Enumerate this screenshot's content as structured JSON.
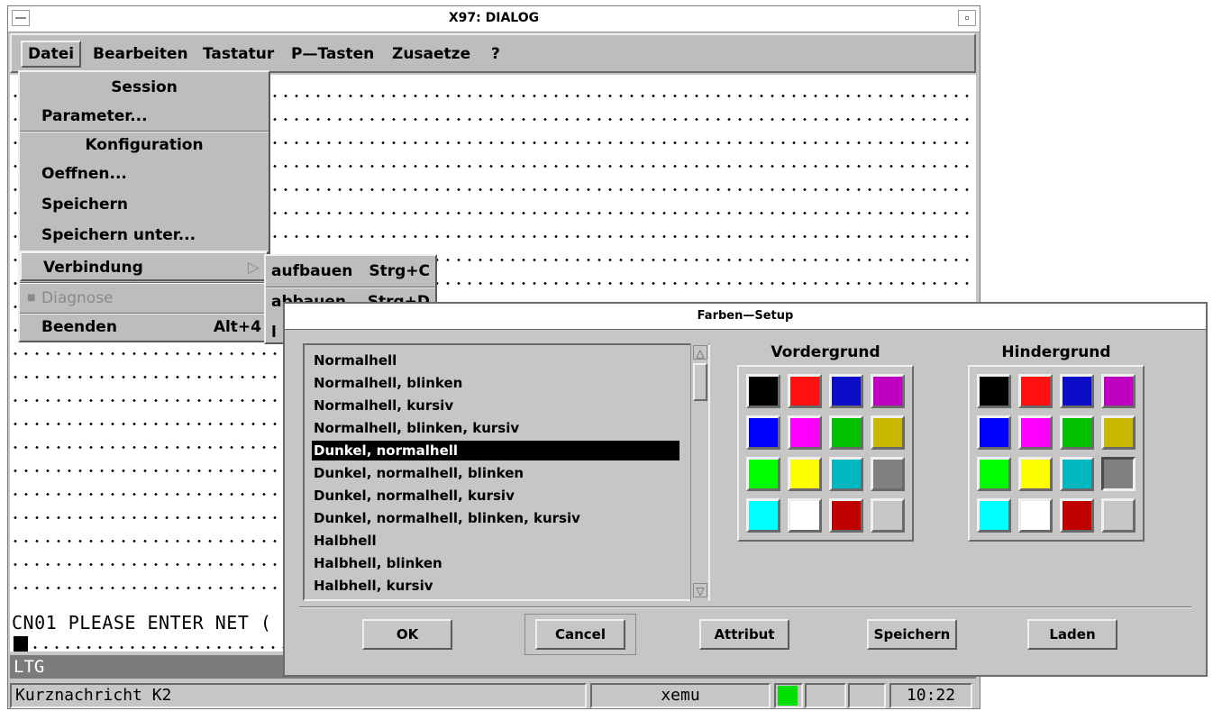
{
  "window": {
    "title": "X97: DIALOG"
  },
  "menubar": {
    "items": [
      {
        "label": "Datei"
      },
      {
        "label": "Bearbeiten"
      },
      {
        "label": "Tastatur"
      },
      {
        "label": "P—Tasten"
      },
      {
        "label": "Zusaetze"
      },
      {
        "label": "?"
      }
    ]
  },
  "datei_menu": {
    "session_header": "Session",
    "parameter": "Parameter...",
    "konfiguration_header": "Konfiguration",
    "oeffnen": "Oeffnen...",
    "speichern": "Speichern",
    "speichern_unter": "Speichern unter...",
    "verbindung": "Verbindung",
    "diagnose": "Diagnose",
    "beenden": "Beenden",
    "beenden_shortcut": "Alt+4"
  },
  "verbindung_submenu": {
    "aufbauen": "aufbauen",
    "aufbauen_shortcut": "Strg+C",
    "abbauen": "abbauen",
    "abbauen_shortcut": "Strg+D",
    "third": "l"
  },
  "terminal": {
    "message": "CN01 PLEASE ENTER NET (",
    "line_label": "LTG"
  },
  "statusbar": {
    "message": "Kurznachricht K2",
    "app": "xemu",
    "led_color": "#00e000",
    "time": "10:22"
  },
  "dialog": {
    "title": "Farben—Setup",
    "attributes": [
      "Normalhell",
      "Normalhell, blinken",
      "Normalhell, kursiv",
      "Normalhell, blinken, kursiv",
      "Dunkel, normalhell",
      "Dunkel, normalhell, blinken",
      "Dunkel, normalhell, kursiv",
      "Dunkel, normalhell, blinken, kursiv",
      "Halbhell",
      "Halbhell, blinken",
      "Halbhell, kursiv"
    ],
    "selected_attribute": "Dunkel, normalhell",
    "foreground_label": "Vordergrund",
    "background_label": "Hindergrund",
    "palette_colors": [
      "#000000",
      "#ff1010",
      "#0c0cc8",
      "#c000c0",
      "#0000ff",
      "#ff00ff",
      "#00c000",
      "#c8b800",
      "#00ff00",
      "#ffff00",
      "#00b8c0",
      "#808080",
      "#00ffff",
      "#ffffff",
      "#c00000",
      "#c6c6c6"
    ],
    "buttons": {
      "ok": "OK",
      "cancel": "Cancel",
      "attribut": "Attribut",
      "speichern": "Speichern",
      "laden": "Laden"
    }
  }
}
